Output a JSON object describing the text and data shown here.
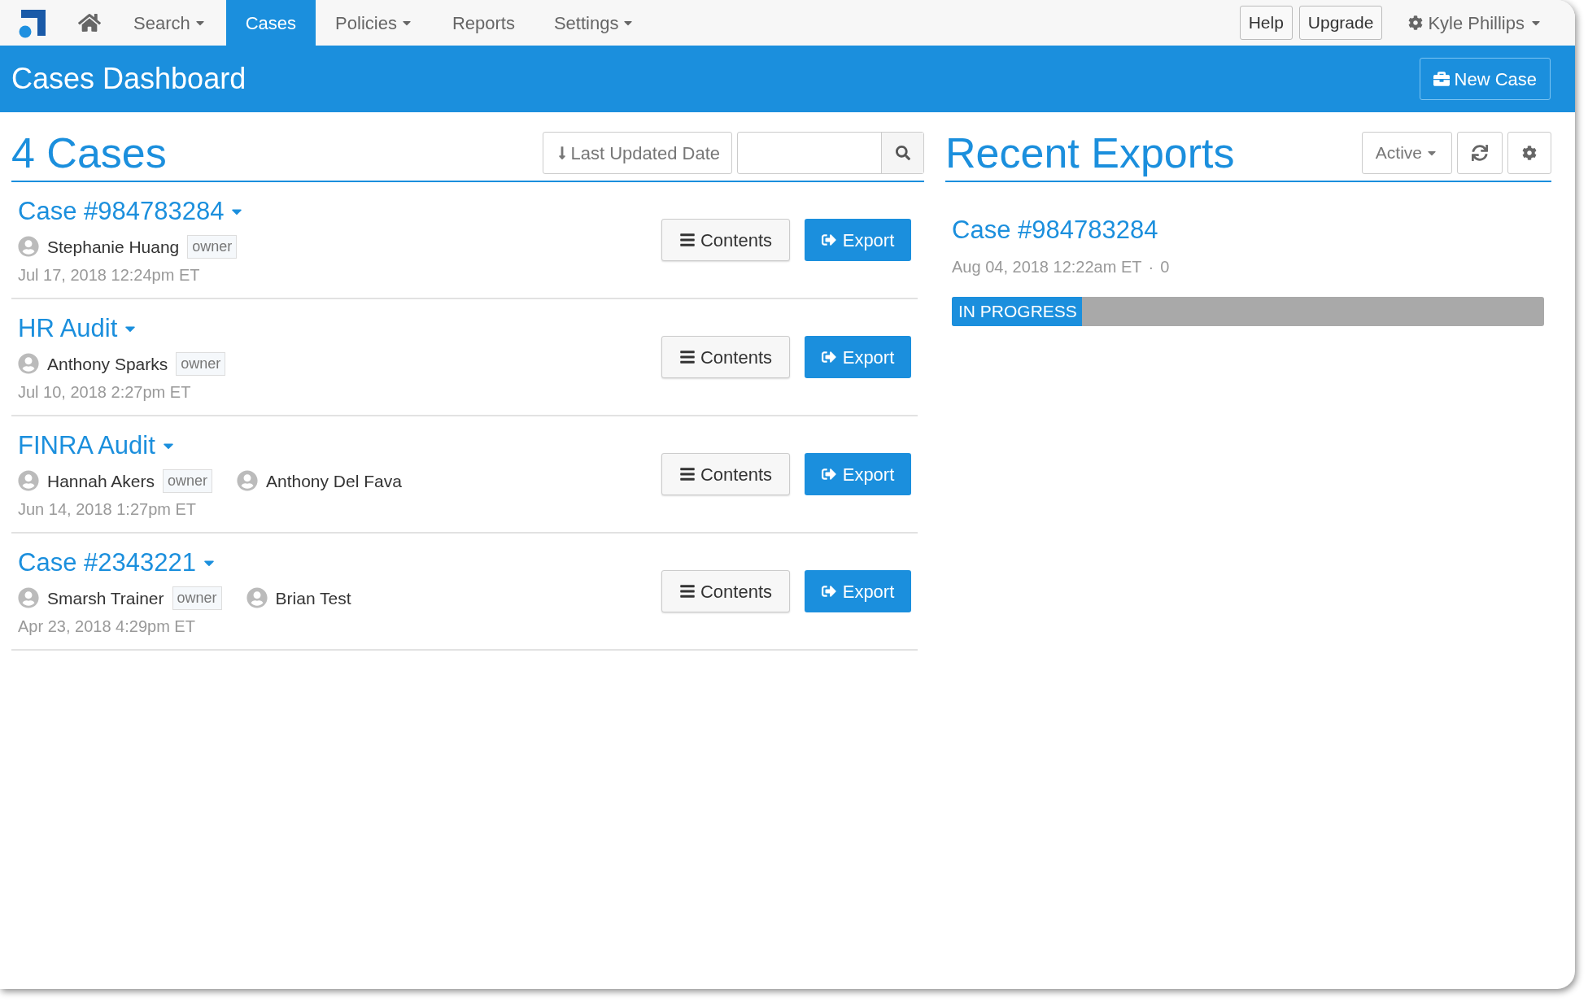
{
  "nav": {
    "items": [
      {
        "label": "Search",
        "dropdown": true,
        "selected": false
      },
      {
        "label": "Cases",
        "dropdown": false,
        "selected": true
      },
      {
        "label": "Policies",
        "dropdown": true,
        "selected": false
      },
      {
        "label": "Reports",
        "dropdown": false,
        "selected": false
      },
      {
        "label": "Settings",
        "dropdown": true,
        "selected": false
      }
    ],
    "buttons": [
      "Help",
      "Upgrade"
    ],
    "user": "Kyle Phillips"
  },
  "header": {
    "title": "Cases Dashboard",
    "new_case_button": "New Case"
  },
  "cases": {
    "title": "4 Cases",
    "sort_button": "Last Updated Date",
    "items": [
      {
        "title": "Case #984783284",
        "people": [
          {
            "name": "Stephanie Huang",
            "role": "owner"
          }
        ],
        "date": "Jul 17, 2018 12:24pm ET",
        "buttons": [
          "Contents",
          "Export"
        ]
      },
      {
        "title": "HR Audit",
        "people": [
          {
            "name": "Anthony Sparks",
            "role": "owner"
          }
        ],
        "date": "Jul 10, 2018 2:27pm ET",
        "buttons": [
          "Contents",
          "Export"
        ]
      },
      {
        "title": "FINRA Audit",
        "people": [
          {
            "name": "Hannah Akers",
            "role": "owner"
          },
          {
            "name": "Anthony Del Fava"
          }
        ],
        "date": "Jun 14, 2018 1:27pm ET",
        "buttons": [
          "Contents",
          "Export"
        ]
      },
      {
        "title": "Case #2343221",
        "people": [
          {
            "name": "Smarsh Trainer",
            "role": "owner"
          },
          {
            "name": "Brian Test"
          }
        ],
        "date": "Apr 23, 2018 4:29pm ET",
        "buttons": [
          "Contents",
          "Export"
        ]
      }
    ]
  },
  "recent_exports": {
    "title": "Recent Exports",
    "filter": "Active",
    "items": [
      {
        "title": "Case #984783284",
        "date": "Aug 04, 2018 12:22am ET",
        "separator": "·",
        "count": "0",
        "status": "IN PROGRESS",
        "level": 0.22
      }
    ]
  }
}
